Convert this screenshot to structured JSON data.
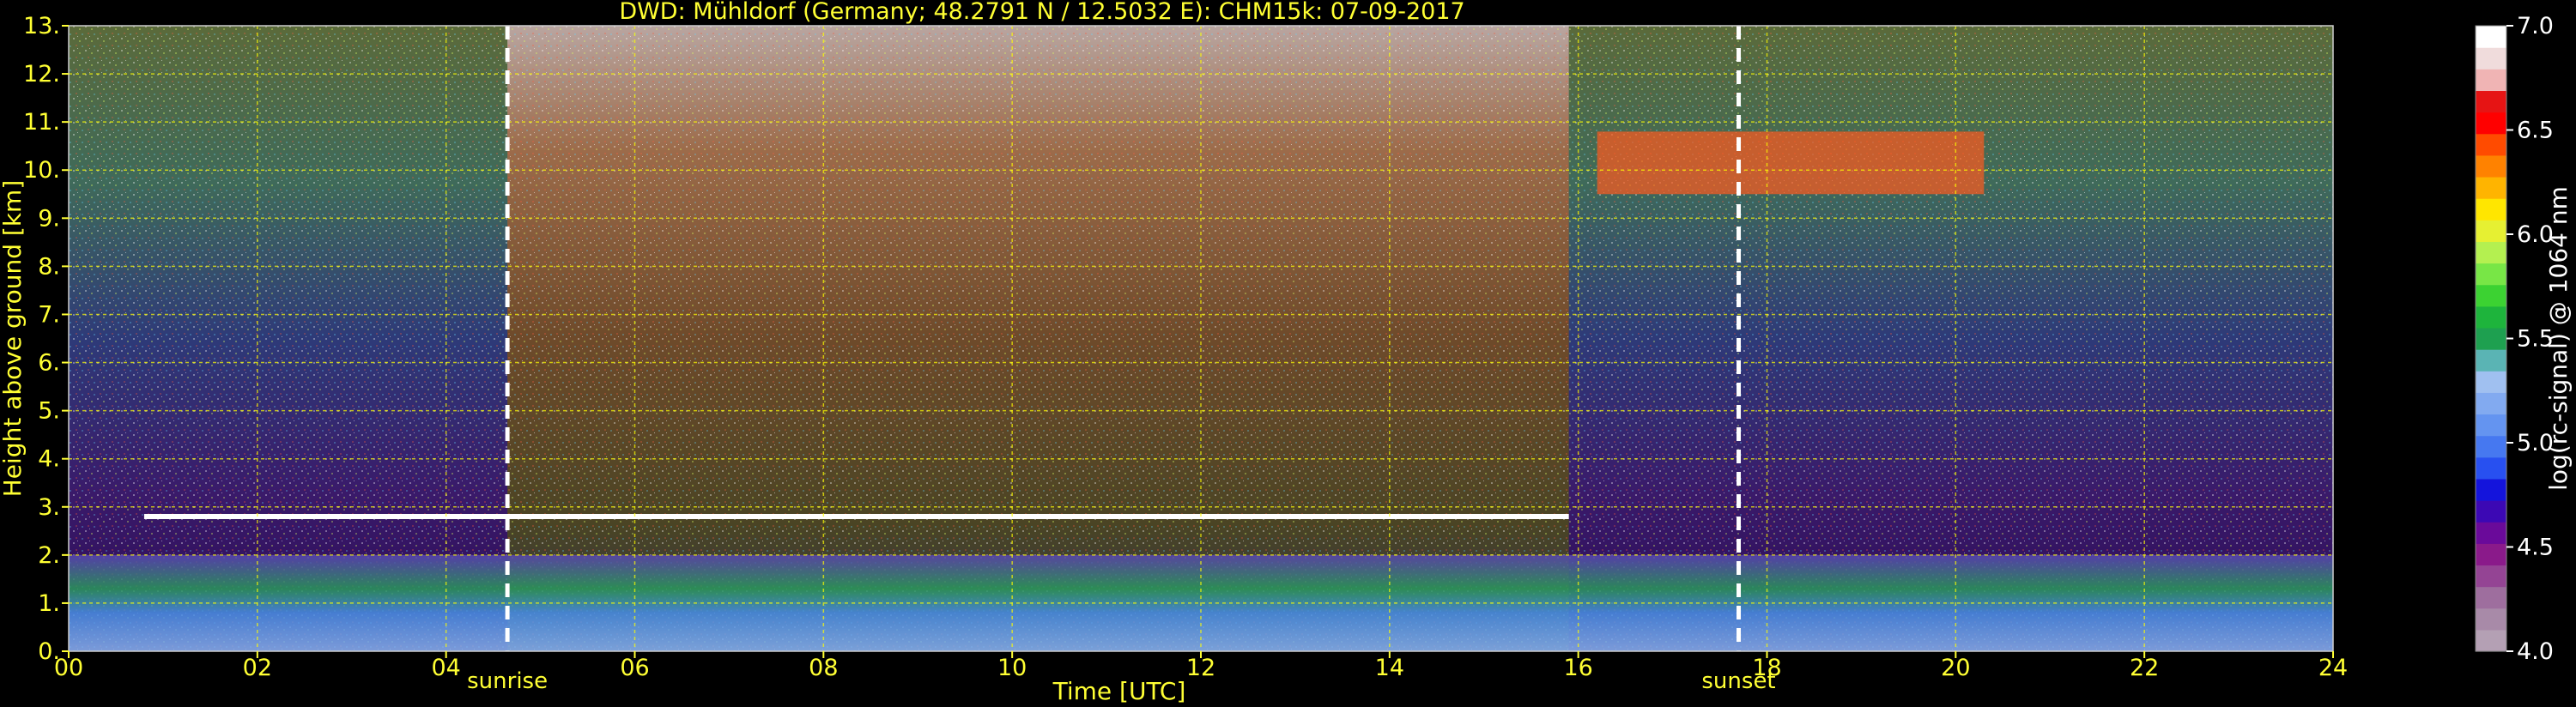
{
  "chart_data": {
    "type": "heatmap",
    "title": "DWD: Mühldorf (Germany; 48.2791 N / 12.5032 E):    CHM15k: 07-09-2017",
    "xlabel": "Time [UTC]",
    "ylabel": "Height above ground [km]",
    "xlim": [
      0,
      24
    ],
    "ylim": [
      0,
      13
    ],
    "x_ticks": [
      "00",
      "02",
      "04",
      "06",
      "08",
      "10",
      "12",
      "14",
      "16",
      "18",
      "20",
      "22",
      "24"
    ],
    "y_ticks": [
      "0.",
      "1.",
      "2.",
      "3.",
      "4.",
      "5.",
      "6.",
      "7.",
      "8.",
      "9.",
      "10.",
      "11.",
      "12.",
      "13."
    ],
    "grid": true,
    "grid_color": "#ffff00",
    "label_color": "#ffff33",
    "markers": [
      {
        "label": "sunrise",
        "x": 4.65
      },
      {
        "label": "sunset",
        "x": 17.7
      }
    ],
    "colorbar": {
      "label": "log(rc-signal) @ 1064 nm",
      "range": [
        4.0,
        7.0
      ],
      "ticks": [
        "4.0",
        "4.5",
        "5.0",
        "5.5",
        "6.0",
        "6.5",
        "7.0"
      ],
      "colors": [
        "#b4a0b4",
        "#a88aa8",
        "#9e6e9e",
        "#944494",
        "#8a1a8a",
        "#6a0a9a",
        "#3c08b4",
        "#1414dc",
        "#2850f0",
        "#4678f0",
        "#6494f0",
        "#82aaf0",
        "#a0c0f0",
        "#5ab4b4",
        "#1ea050",
        "#1eb43c",
        "#3cd232",
        "#78e646",
        "#b4f050",
        "#e6f032",
        "#ffe600",
        "#ffb400",
        "#ff8200",
        "#ff4b00",
        "#ff0000",
        "#e61414",
        "#f0b4b4",
        "#f0dcdc",
        "#ffffff"
      ]
    },
    "layers": [
      {
        "name": "boundary layer",
        "x_range": [
          0,
          24
        ],
        "height_range": [
          0,
          2.0
        ]
      },
      {
        "name": "cloud layer",
        "x_range": [
          0.8,
          15.9
        ],
        "height_km": 2.8
      },
      {
        "name": "cirrus",
        "x_range": [
          16.2,
          20.3
        ],
        "height_range": [
          9.5,
          10.8
        ]
      }
    ]
  }
}
